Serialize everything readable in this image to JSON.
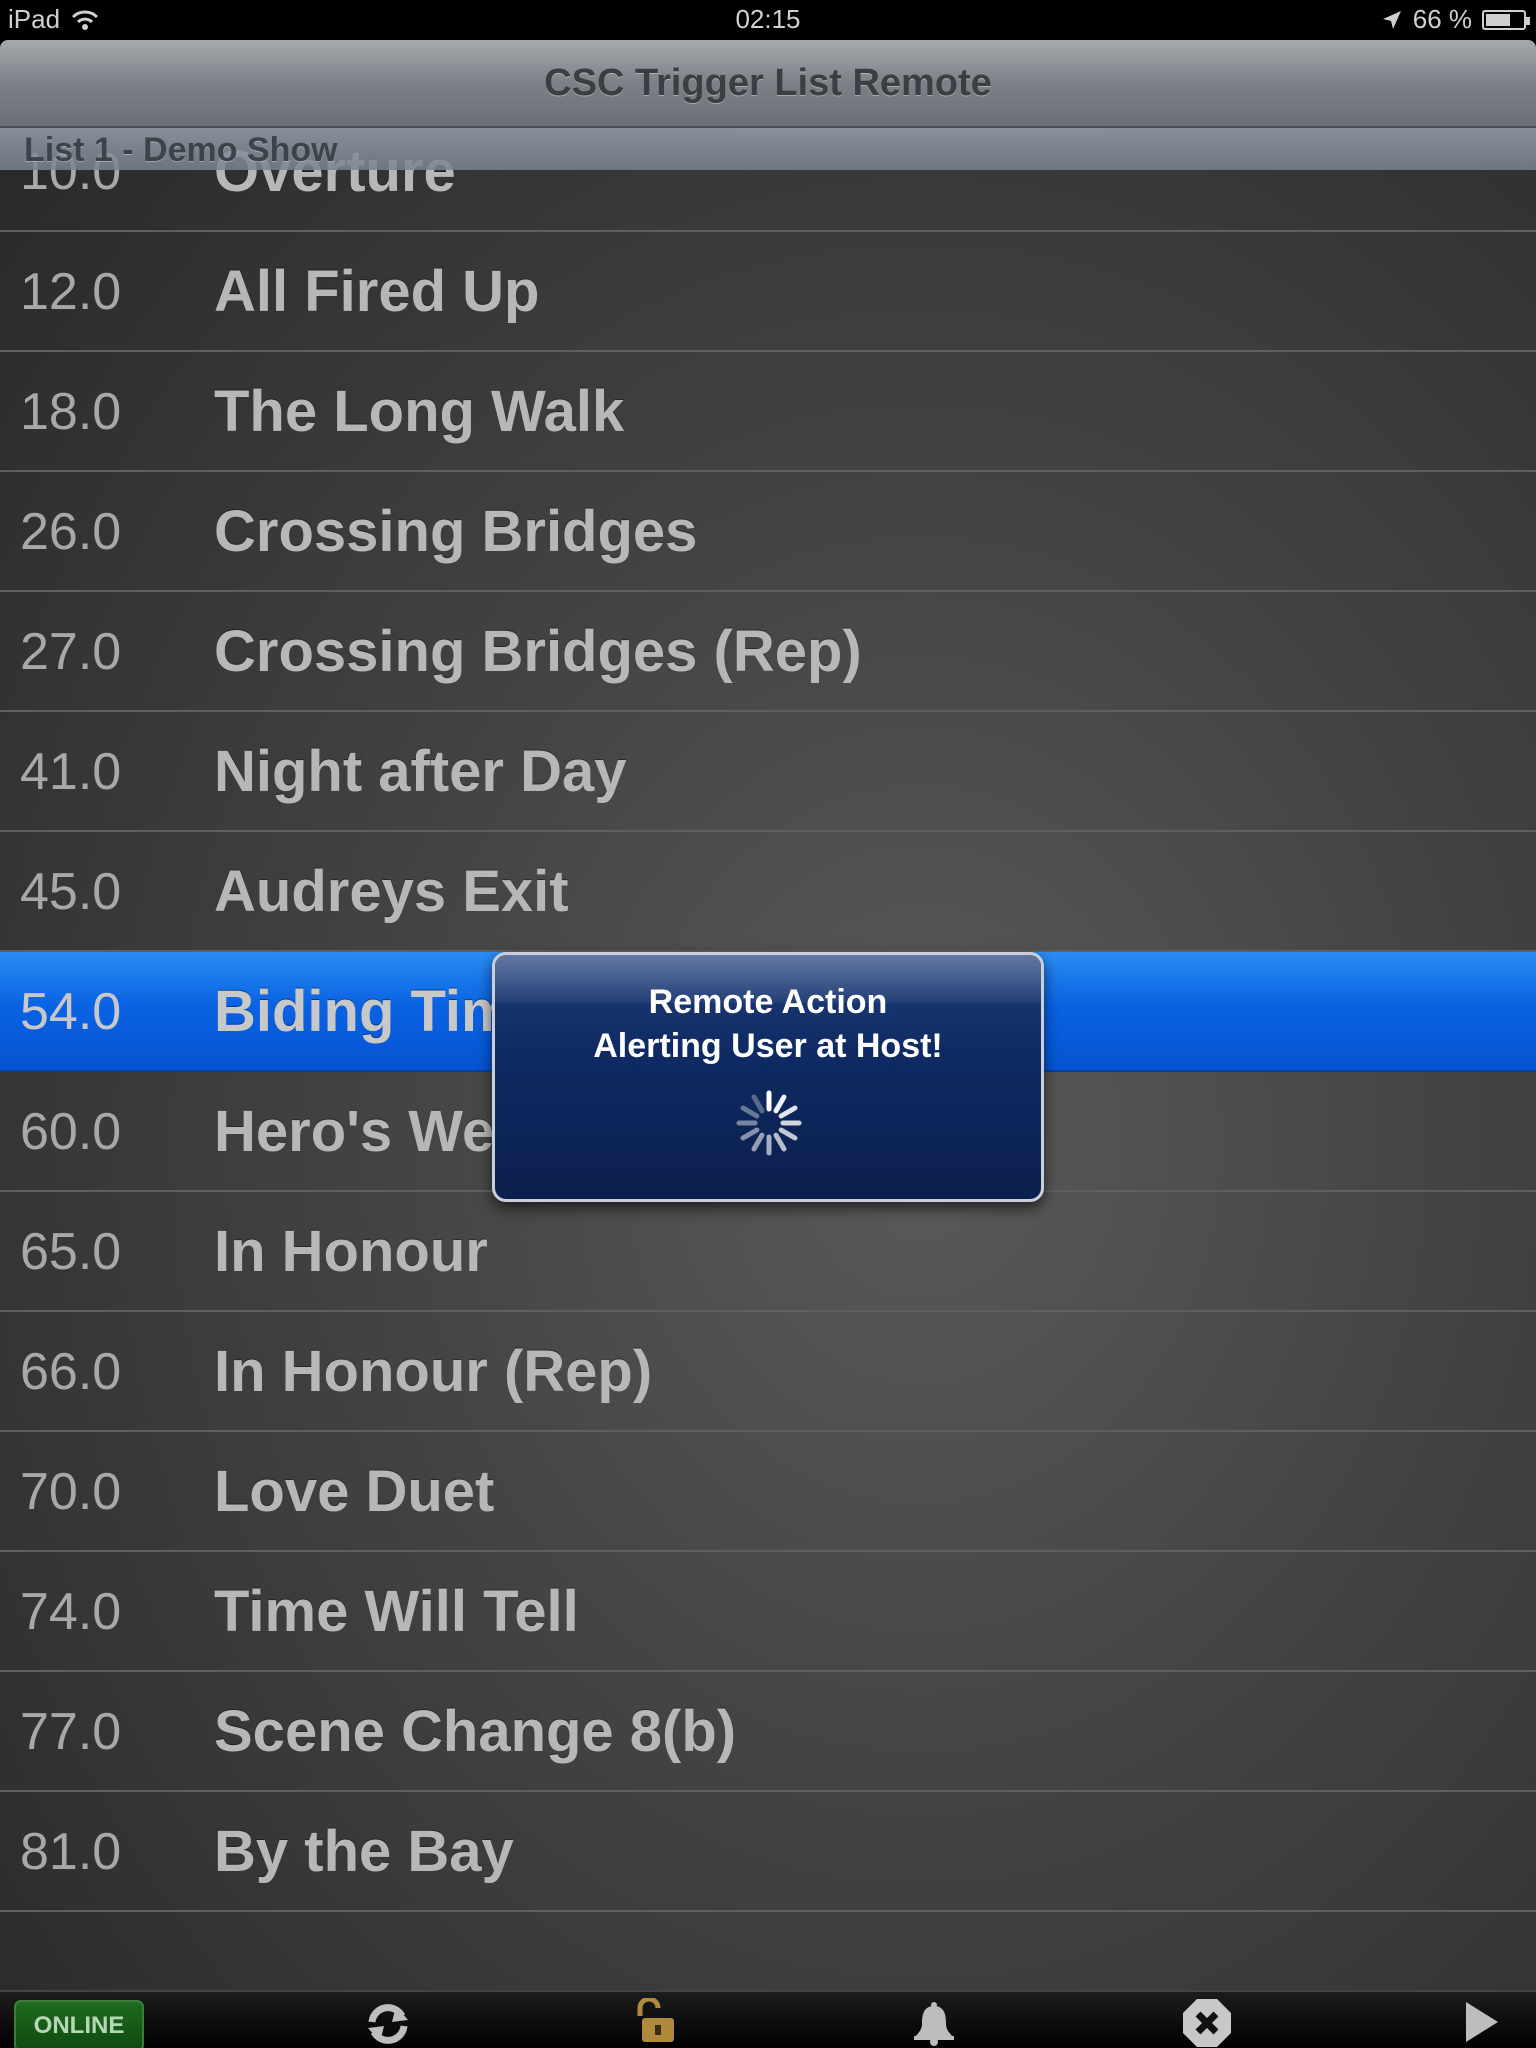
{
  "status_bar": {
    "device": "iPad",
    "time": "02:15",
    "battery": "66 %",
    "battery_level": 0.66
  },
  "nav_bar": {
    "title": "CSC Trigger List Remote"
  },
  "section_header": "List 1 - Demo Show",
  "rows": [
    {
      "num": "10.0",
      "title": "Overture"
    },
    {
      "num": "12.0",
      "title": "All Fired Up"
    },
    {
      "num": "18.0",
      "title": "The Long Walk"
    },
    {
      "num": "26.0",
      "title": "Crossing Bridges"
    },
    {
      "num": "27.0",
      "title": "Crossing Bridges (Rep)"
    },
    {
      "num": "41.0",
      "title": "Night after Day"
    },
    {
      "num": "45.0",
      "title": "Audreys Exit"
    },
    {
      "num": "54.0",
      "title": "Biding Time"
    },
    {
      "num": "60.0",
      "title": "Hero's Welcome"
    },
    {
      "num": "65.0",
      "title": "In Honour"
    },
    {
      "num": "66.0",
      "title": "In Honour (Rep)"
    },
    {
      "num": "70.0",
      "title": "Love Duet"
    },
    {
      "num": "74.0",
      "title": "Time Will Tell"
    },
    {
      "num": "77.0",
      "title": "Scene Change 8(b)"
    },
    {
      "num": "81.0",
      "title": "By the Bay"
    }
  ],
  "selected_row": "54.0",
  "hud": {
    "line1": "Remote Action",
    "line2": "Alerting User at Host!"
  },
  "toolbar": {
    "online_label": "ONLINE",
    "icons": [
      "refresh-icon",
      "unlocked-padlock-icon",
      "bell-icon",
      "stop-close-icon",
      "play-icon"
    ]
  },
  "colors": {
    "selection": "#0a63e3",
    "hud": "#0f2a63",
    "online": "#1f6b1f",
    "padlock": "#b08a3c"
  }
}
